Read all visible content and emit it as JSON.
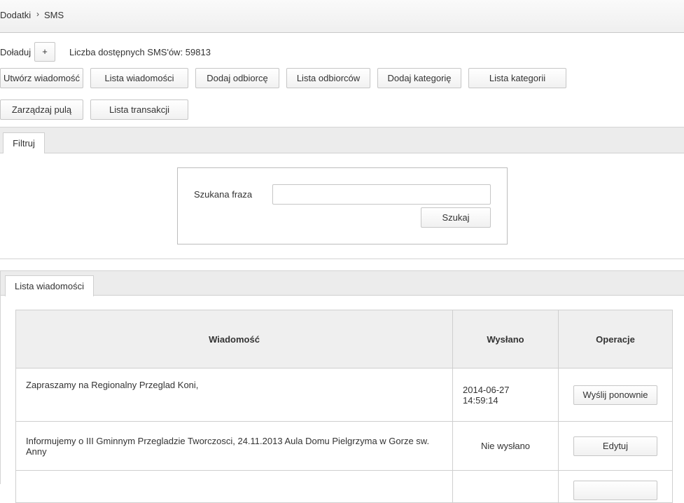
{
  "breadcrumb": {
    "parent": "Dodatki",
    "separator": "›",
    "current": "SMS"
  },
  "balance": {
    "topup_label": "Doładuj",
    "topup_button": "+",
    "available_text": "Liczba dostępnych SMS'ów: 59813"
  },
  "actions": {
    "create_message": "Utwórz wiadomość",
    "message_list": "Lista wiadomości",
    "add_recipient": "Dodaj odbiorcę",
    "recipient_list": "Lista odbiorców",
    "add_category": "Dodaj kategorię",
    "category_list": "Lista kategorii",
    "manage_pool": "Zarządzaj pulą",
    "transaction_list": "Lista transakcji"
  },
  "filter": {
    "tab": "Filtruj",
    "phrase_label": "Szukana fraza",
    "phrase_value": "",
    "search_button": "Szukaj"
  },
  "messages": {
    "tab": "Lista wiadomości",
    "headers": {
      "message": "Wiadomość",
      "sent": "Wysłano",
      "operations": "Operacje"
    },
    "rows": [
      {
        "message": "Zapraszamy na Regionalny Przeglad Koni,",
        "sent_date": "2014-06-27",
        "sent_time": "14:59:14",
        "action": "Wyślij ponownie"
      },
      {
        "message": "Informujemy o III Gminnym Przegladzie Tworczosci, 24.11.2013 Aula Domu Pielgrzyma w Gorze sw. Anny",
        "sent_date": "Nie wysłano",
        "sent_time": "",
        "action": "Edytuj"
      }
    ]
  }
}
